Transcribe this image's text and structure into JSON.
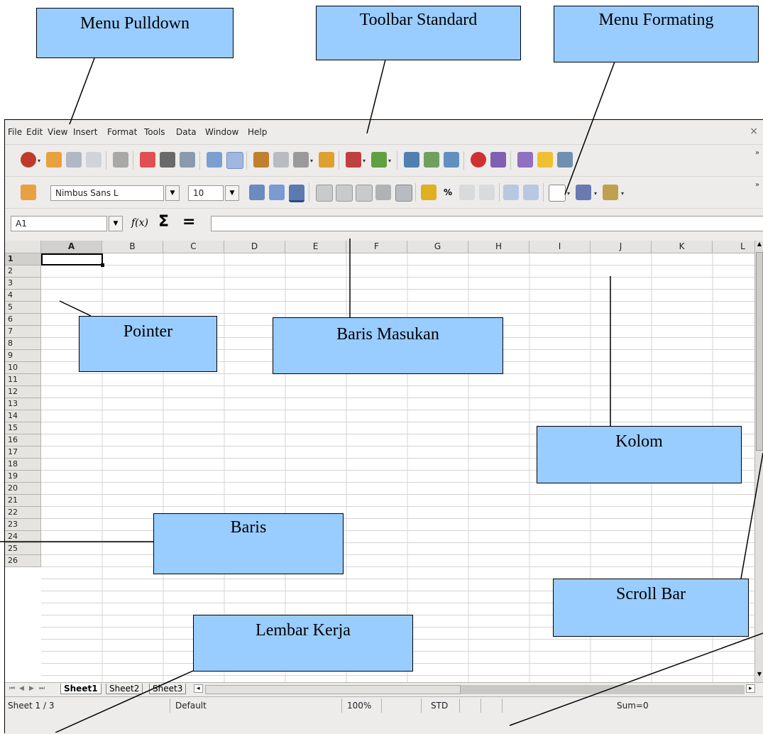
{
  "menu": {
    "items": [
      "File",
      "Edit",
      "View",
      "Insert",
      "Format",
      "Tools",
      "Data",
      "Window",
      "Help"
    ],
    "close": "×"
  },
  "format_toolbar": {
    "font_name": "Nimbus Sans L",
    "font_size": "10",
    "percent": "%"
  },
  "formula_bar": {
    "name_box": "A1",
    "fx": "f(x)",
    "sigma": "Σ",
    "equals": "="
  },
  "columns": [
    "A",
    "B",
    "C",
    "D",
    "E",
    "F",
    "G",
    "H",
    "I",
    "J",
    "K",
    "L"
  ],
  "rows": [
    "1",
    "2",
    "3",
    "4",
    "5",
    "6",
    "7",
    "8",
    "9",
    "10",
    "11",
    "12",
    "13",
    "14",
    "15",
    "16",
    "17",
    "18",
    "19",
    "20",
    "21",
    "22",
    "23",
    "24",
    "25",
    "26"
  ],
  "sheet_tabs": [
    "Sheet1",
    "Sheet2",
    "Sheet3"
  ],
  "status": {
    "sheet": "Sheet 1 / 3",
    "style": "Default",
    "zoom": "100%",
    "mode": "STD",
    "sum": "Sum=0"
  },
  "callouts": {
    "menu_pulldown": "Menu Pulldown",
    "toolbar_standard": "Toolbar Standard",
    "menu_formating": "Menu Formating",
    "pointer": "Pointer",
    "baris_masukan": "Baris Masukan",
    "kolom": "Kolom",
    "baris": "Baris",
    "scroll_bar": "Scroll Bar",
    "lembar_kerja": "Lembar Kerja"
  },
  "colors": {
    "callout_fill": "#99ccff",
    "ui_background": "#edeceb",
    "header_fill": "#e6e4e1"
  }
}
